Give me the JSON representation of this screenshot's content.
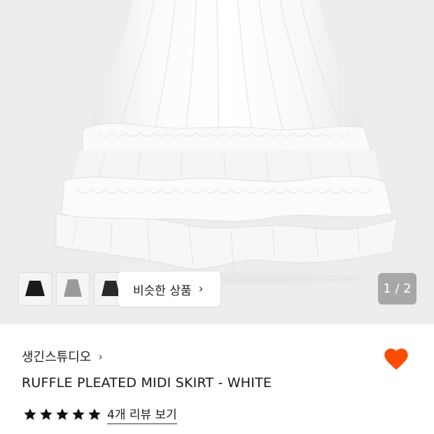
{
  "product_image": {
    "alt_subject": "white ruffle pleated midi skirt",
    "background_color": "#ededef"
  },
  "thumbnails": [
    {
      "name": "black-skirt-thumbnail",
      "color": "#1b1b1b"
    },
    {
      "name": "gray-skirt-thumbnail",
      "color": "#9a9a9a"
    },
    {
      "name": "dark-skirt-thumbnail",
      "color": "#2a2a2a"
    }
  ],
  "similar_button": {
    "label": "비슷한 상품",
    "chevron": "›"
  },
  "pager": {
    "current": "1",
    "separator": " / ",
    "total": "2"
  },
  "brand": {
    "name": "생긴스튜디오",
    "chevron": "›"
  },
  "product": {
    "title": "RUFFLE PLEATED MIDI SKIRT - WHITE"
  },
  "wishlist": {
    "icon": "heart-icon",
    "color": "#fc4c02",
    "active": true
  },
  "rating": {
    "stars": 5,
    "max": 5,
    "review_link": "4개 리뷰 보기"
  },
  "colors": {
    "accent": "#fc4c02",
    "text": "#111111"
  }
}
